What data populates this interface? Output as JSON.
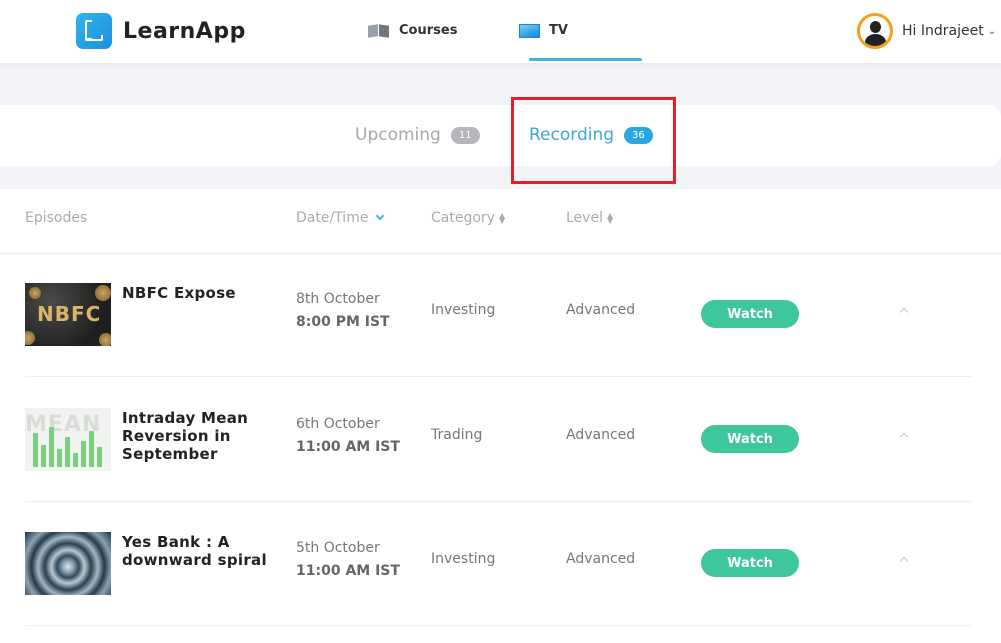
{
  "header": {
    "logo_text": "LearnApp",
    "nav": [
      {
        "label": "Courses",
        "icon": "book-icon"
      },
      {
        "label": "TV",
        "icon": "tv-icon"
      }
    ],
    "user_greeting": "Hi Indrajeet"
  },
  "tabs": [
    {
      "label": "Upcoming",
      "count": "11",
      "active": false
    },
    {
      "label": "Recording",
      "count": "36",
      "active": true
    }
  ],
  "table": {
    "columns": [
      "Episodes",
      "Date/Time",
      "Category",
      "Level"
    ],
    "rows": [
      {
        "title": "NBFC Expose",
        "thumb_text": "NBFC",
        "date": "8th October",
        "time": "8:00 PM IST",
        "category": "Investing",
        "level": "Advanced",
        "action": "Watch"
      },
      {
        "title": "Intraday Mean Reversion in September",
        "thumb_text": "MEAN",
        "date": "6th October",
        "time": "11:00 AM IST",
        "category": "Trading",
        "level": "Advanced",
        "action": "Watch"
      },
      {
        "title": "Yes Bank : A downward spiral",
        "thumb_text": "",
        "date": "5th October",
        "time": "11:00 AM IST",
        "category": "Investing",
        "level": "Advanced",
        "action": "Watch"
      }
    ]
  },
  "colors": {
    "accent_blue": "#36a9d6",
    "watch_green": "#3ec79c",
    "highlight_red": "#e3202a",
    "avatar_ring": "#f3a11b"
  }
}
